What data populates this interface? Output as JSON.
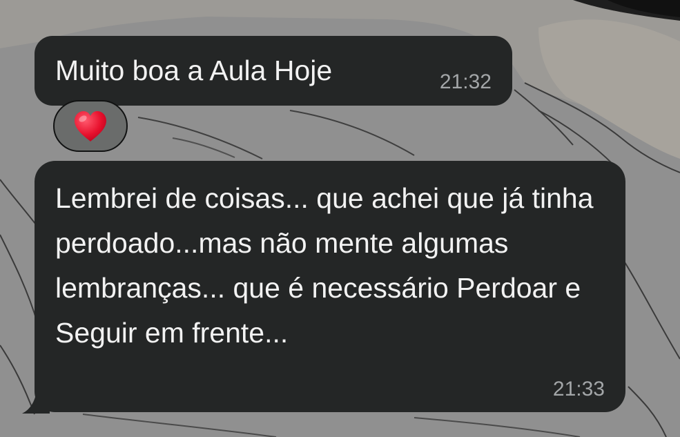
{
  "messages": [
    {
      "text": "Muito boa a Aula Hoje",
      "time": "21:32",
      "reaction": "heart-emoji"
    },
    {
      "text": "Lembrei de coisas... que achei que já tinha perdoado...mas não mente algumas lembranças... que é necessário Perdoar e Seguir em frente...",
      "time": "21:33"
    }
  ],
  "colors": {
    "bubble": "#242626",
    "text": "#f2f2f2",
    "timestamp": "#a3a6a8",
    "reaction_pill": "#6a6c6b",
    "heart": "#e8112d"
  }
}
